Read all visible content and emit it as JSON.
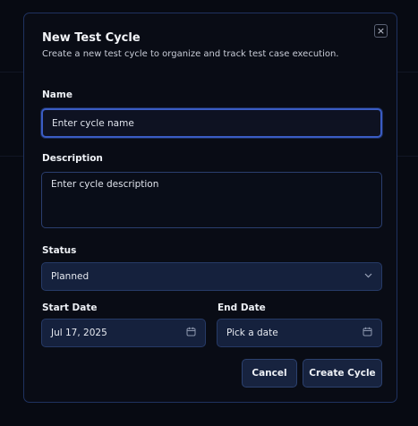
{
  "dialog": {
    "title": "New Test Cycle",
    "subtitle": "Create a new test cycle to organize and track test case execution.",
    "close_icon": "×"
  },
  "form": {
    "name": {
      "label": "Name",
      "placeholder": "Enter cycle name",
      "value": ""
    },
    "description": {
      "label": "Description",
      "placeholder": "Enter cycle description",
      "value": ""
    },
    "status": {
      "label": "Status",
      "value": "Planned",
      "chevron_icon": "⌄"
    },
    "start_date": {
      "label": "Start Date",
      "value": "Jul 17, 2025",
      "calendar_icon": "▭"
    },
    "end_date": {
      "label": "End Date",
      "value": "Pick a date",
      "calendar_icon": "▭"
    }
  },
  "actions": {
    "cancel_label": "Cancel",
    "submit_label": "Create Cycle"
  }
}
